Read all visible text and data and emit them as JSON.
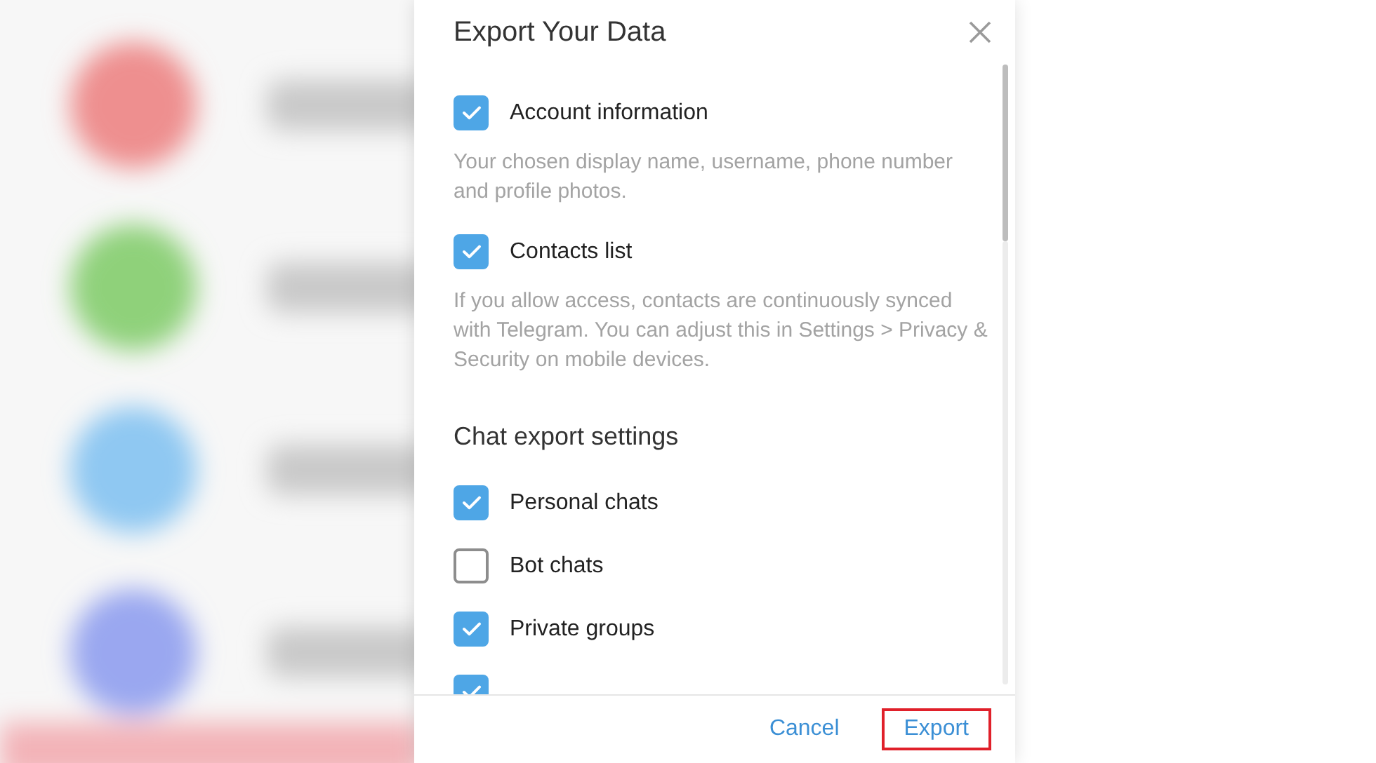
{
  "dialog": {
    "title": "Export Your Data",
    "sections": [
      {
        "items": [
          {
            "label": "Account information",
            "checked": true,
            "description": "Your chosen display name, username, phone number and profile photos."
          },
          {
            "label": "Contacts list",
            "checked": true,
            "description": "If you allow access, contacts are continuously synced with Telegram. You can adjust this in Settings > Privacy & Security on mobile devices."
          }
        ]
      },
      {
        "heading": "Chat export settings",
        "items": [
          {
            "label": "Personal chats",
            "checked": true
          },
          {
            "label": "Bot chats",
            "checked": false
          },
          {
            "label": "Private groups",
            "checked": true
          },
          {
            "checked": true
          }
        ]
      }
    ],
    "buttons": [
      {
        "label": "Cancel",
        "highlighted": false
      },
      {
        "label": "Export",
        "highlighted": true
      }
    ]
  }
}
